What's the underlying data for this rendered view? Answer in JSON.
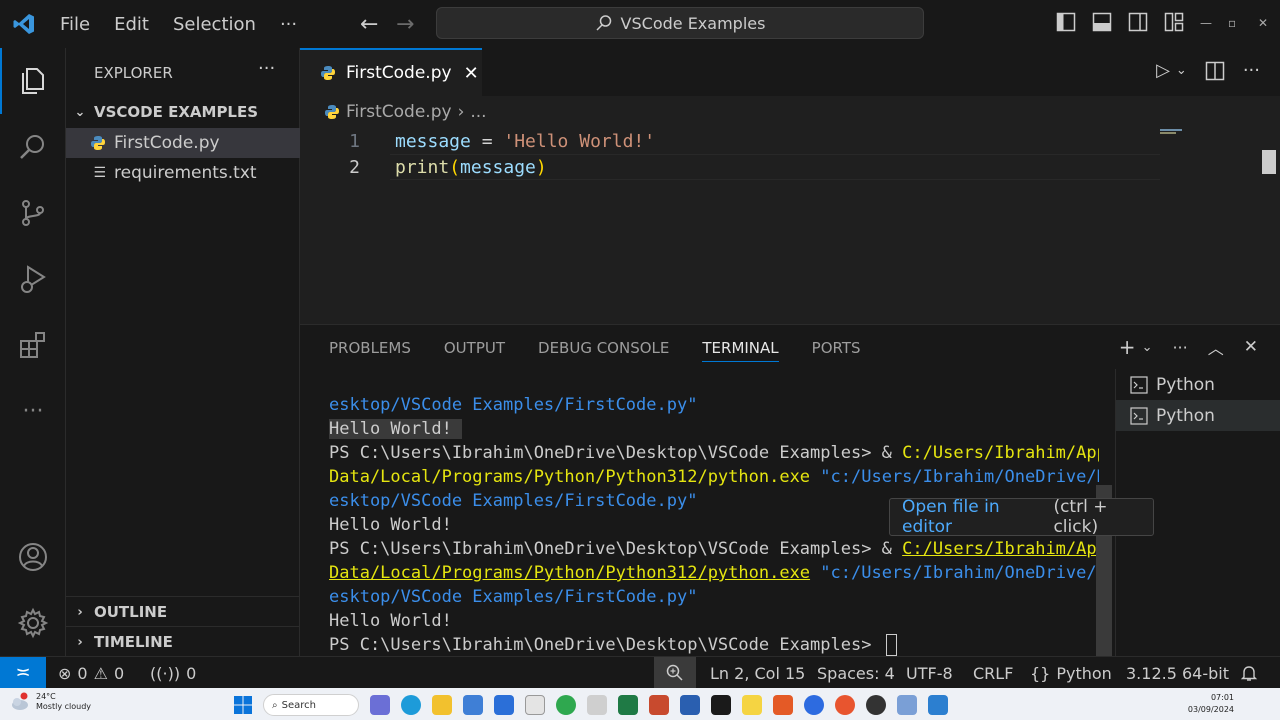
{
  "titlebar": {
    "menu": [
      "File",
      "Edit",
      "Selection",
      "···"
    ],
    "search": "VSCode Examples"
  },
  "sidebar": {
    "title": "EXPLORER",
    "more": "···",
    "folder": "VSCODE EXAMPLES",
    "files": [
      {
        "name": "FirstCode.py",
        "selected": true
      },
      {
        "name": "requirements.txt",
        "selected": false
      }
    ],
    "outline": "OUTLINE",
    "timeline": "TIMELINE"
  },
  "editor": {
    "tab": "FirstCode.py",
    "breadcrumb_file": "FirstCode.py",
    "breadcrumb_more": "...",
    "lines": [
      {
        "num": "1",
        "parts": [
          [
            "var",
            "message"
          ],
          [
            "op",
            " = "
          ],
          [
            "str",
            "'Hello World!'"
          ]
        ]
      },
      {
        "num": "2",
        "parts": [
          [
            "fn",
            "print"
          ],
          [
            "paren",
            "("
          ],
          [
            "var",
            "message"
          ],
          [
            "paren",
            ")"
          ]
        ]
      }
    ]
  },
  "panel": {
    "tabs": [
      "PROBLEMS",
      "OUTPUT",
      "DEBUG CONSOLE",
      "TERMINAL",
      "PORTS"
    ],
    "active_tab": "TERMINAL",
    "terminal_lines": [
      [
        [
          "t-path",
          "esktop/VSCode Examples/FirstCode.py\""
        ]
      ],
      [
        [
          "t-out hl",
          "Hello World! "
        ]
      ],
      [
        [
          "t-ps",
          "PS C:\\Users\\Ibrahim\\OneDrive\\Desktop\\VSCode Examples> & "
        ],
        [
          "t-yellow",
          "C:/Users/Ibrahim/App"
        ]
      ],
      [
        [
          "t-yellow",
          "Data/Local/Programs/Python/Python312/python.exe"
        ],
        [
          "t-ps",
          " "
        ],
        [
          "t-cyan",
          "\"c:/Users/Ibrahim/OneDrive/D"
        ]
      ],
      [
        [
          "t-path",
          "esktop/VSCode Examples/FirstCode.py\""
        ]
      ],
      [
        [
          "t-out",
          "Hello World!"
        ]
      ],
      [
        [
          "t-ps",
          "PS C:\\Users\\Ibrahim\\OneDrive\\Desktop\\VSCode Examples> & "
        ],
        [
          "t-yellow ul",
          "C:/Users/Ibrahim/App"
        ]
      ],
      [
        [
          "t-yellow ul",
          "Data/Local/Programs/Python/Python312/python.exe"
        ],
        [
          "t-ps",
          " "
        ],
        [
          "t-cyan",
          "\"c:/Users/Ibrahim/OneDrive/D"
        ]
      ],
      [
        [
          "t-path",
          "esktop/VSCode Examples/FirstCode.py\""
        ]
      ],
      [
        [
          "t-out",
          "Hello World!"
        ]
      ],
      [
        [
          "t-ps",
          "PS C:\\Users\\Ibrahim\\OneDrive\\Desktop\\VSCode Examples> "
        ]
      ]
    ],
    "terminals": [
      "Python",
      "Python"
    ],
    "tooltip_link": "Open file in editor",
    "tooltip_hint": "(ctrl + click)"
  },
  "statusbar": {
    "errors": "0",
    "warnings": "0",
    "ports": "0",
    "position": "Ln 2, Col 15",
    "spaces": "Spaces: 4",
    "encoding": "UTF-8",
    "eol": "CRLF",
    "language": "Python",
    "interpreter": "3.12.5 64-bit"
  },
  "taskbar": {
    "temperature": "24°C",
    "weather": "Mostly cloudy",
    "search": "Search",
    "time": "07:01",
    "date": "03/09/2024"
  },
  "colors": {
    "accent": "#0078d4",
    "background": "#1f1f1f",
    "sidebar": "#181818"
  }
}
